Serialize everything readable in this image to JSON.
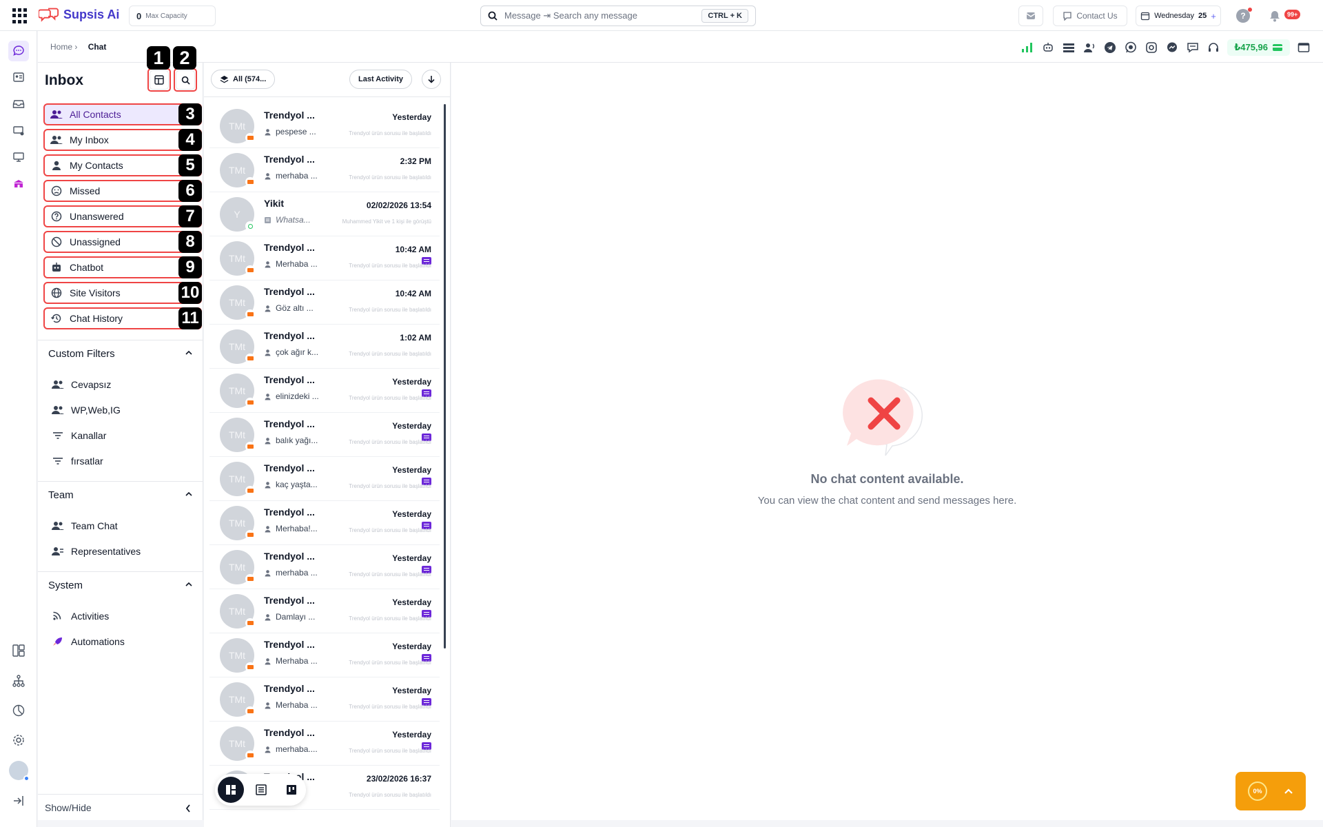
{
  "app": {
    "name": "Supsis Ai"
  },
  "topbar": {
    "capacity_value": "0",
    "capacity_label": "Max Capacity",
    "search_placeholder": "Message ⇥ Search any message",
    "search_shortcut": "CTRL + K",
    "contact_us": "Contact Us",
    "date_day": "Wednesday",
    "date_num": "25",
    "notifications": "99+"
  },
  "breadcrumb": {
    "home": "Home ›",
    "current": "Chat"
  },
  "balance": "₺475,96",
  "inbox": {
    "title": "Inbox",
    "markers": {
      "layout": "1",
      "search": "2"
    },
    "nav": [
      {
        "label": "All Contacts",
        "num": "3",
        "icon": "users-icon"
      },
      {
        "label": "My Inbox",
        "num": "4",
        "icon": "users-icon"
      },
      {
        "label": "My Contacts",
        "num": "5",
        "icon": "user-icon"
      },
      {
        "label": "Missed",
        "num": "6",
        "icon": "sad-face-icon"
      },
      {
        "label": "Unanswered",
        "num": "7",
        "icon": "question-icon"
      },
      {
        "label": "Unassigned",
        "num": "8",
        "icon": "block-icon"
      },
      {
        "label": "Chatbot",
        "num": "9",
        "icon": "robot-icon"
      },
      {
        "label": "Site Visitors",
        "num": "10",
        "icon": "globe-icon"
      },
      {
        "label": "Chat History",
        "num": "11",
        "icon": "history-icon"
      }
    ],
    "custom_filters": {
      "title": "Custom Filters",
      "items": [
        "Cevapsız",
        "WP,Web,IG",
        "Kanallar",
        "fırsatlar"
      ]
    },
    "team": {
      "title": "Team",
      "items": [
        "Team Chat",
        "Representatives"
      ]
    },
    "system": {
      "title": "System",
      "items": [
        "Activities",
        "Automations"
      ]
    },
    "show_hide": "Show/Hide"
  },
  "conversations": {
    "filter_label": "All (574...",
    "sort_label": "Last Activity",
    "items": [
      {
        "avatar": "TMt",
        "name": "Trendyol ...",
        "time": "Yesterday",
        "preview": "pespese ...",
        "tag": "Trendyol ürün sorusu ile başlatıldı",
        "channel": "trendyol",
        "unread": false
      },
      {
        "avatar": "TMt",
        "name": "Trendyol ...",
        "time": "2:32 PM",
        "preview": "merhaba ...",
        "tag": "Trendyol ürün sorusu ile başlatıldı",
        "channel": "trendyol",
        "unread": false
      },
      {
        "avatar": "Y",
        "name": "Yikit",
        "time": "02/02/2026 13:54",
        "preview": "Whatsa...",
        "tag": "Muhammed Yikit ve 1 kişi ile görüştü",
        "channel": "whatsapp",
        "unread": false
      },
      {
        "avatar": "TMt",
        "name": "Trendyol ...",
        "time": "10:42 AM",
        "preview": "Merhaba ...",
        "tag": "Trendyol ürün sorusu ile başlatıldı",
        "channel": "trendyol",
        "unread": true
      },
      {
        "avatar": "TMt",
        "name": "Trendyol ...",
        "time": "10:42 AM",
        "preview": "Göz altı ...",
        "tag": "Trendyol ürün sorusu ile başlatıldı",
        "channel": "trendyol",
        "unread": false
      },
      {
        "avatar": "TMt",
        "name": "Trendyol ...",
        "time": "1:02 AM",
        "preview": "çok ağır k...",
        "tag": "Trendyol ürün sorusu ile başlatıldı",
        "channel": "trendyol",
        "unread": false
      },
      {
        "avatar": "TMt",
        "name": "Trendyol ...",
        "time": "Yesterday",
        "preview": "elinizdeki ...",
        "tag": "Trendyol ürün sorusu ile başlatıldı",
        "channel": "trendyol",
        "unread": true
      },
      {
        "avatar": "TMt",
        "name": "Trendyol ...",
        "time": "Yesterday",
        "preview": "balık yağı...",
        "tag": "Trendyol ürün sorusu ile başlatıldı",
        "channel": "trendyol",
        "unread": true
      },
      {
        "avatar": "TMt",
        "name": "Trendyol ...",
        "time": "Yesterday",
        "preview": "kaç yaşta...",
        "tag": "Trendyol ürün sorusu ile başlatıldı",
        "channel": "trendyol",
        "unread": true
      },
      {
        "avatar": "TMt",
        "name": "Trendyol ...",
        "time": "Yesterday",
        "preview": "Merhaba!...",
        "tag": "Trendyol ürün sorusu ile başlatıldı",
        "channel": "trendyol",
        "unread": true
      },
      {
        "avatar": "TMt",
        "name": "Trendyol ...",
        "time": "Yesterday",
        "preview": "merhaba ...",
        "tag": "Trendyol ürün sorusu ile başlatıldı",
        "channel": "trendyol",
        "unread": true
      },
      {
        "avatar": "TMt",
        "name": "Trendyol ...",
        "time": "Yesterday",
        "preview": "Damlayı ...",
        "tag": "Trendyol ürün sorusu ile başlatıldı",
        "channel": "trendyol",
        "unread": true
      },
      {
        "avatar": "TMt",
        "name": "Trendyol ...",
        "time": "Yesterday",
        "preview": "Merhaba ...",
        "tag": "Trendyol ürün sorusu ile başlatıldı",
        "channel": "trendyol",
        "unread": true
      },
      {
        "avatar": "TMt",
        "name": "Trendyol ...",
        "time": "Yesterday",
        "preview": "Merhaba ...",
        "tag": "Trendyol ürün sorusu ile başlatıldı",
        "channel": "trendyol",
        "unread": true
      },
      {
        "avatar": "TMt",
        "name": "Trendyol ...",
        "time": "Yesterday",
        "preview": "merhaba....",
        "tag": "Trendyol ürün sorusu ile başlatıldı",
        "channel": "trendyol",
        "unread": true
      },
      {
        "avatar": "TMt",
        "name": "Trendyol ...",
        "time": "23/02/2026 16:37",
        "preview": "",
        "tag": "Trendyol ürün sorusu ile başlatıldı",
        "channel": "trendyol",
        "unread": false
      }
    ]
  },
  "empty_state": {
    "title": "No chat content available.",
    "subtitle": "You can view the chat content and send messages here."
  },
  "progress_widget": {
    "percent": "0%",
    "value": 0
  },
  "colors": {
    "accent": "#4338ca",
    "highlight": "#ef4444",
    "active_bg": "#ede9fe",
    "balance": "#16a34a",
    "widget": "#f59e0b"
  }
}
